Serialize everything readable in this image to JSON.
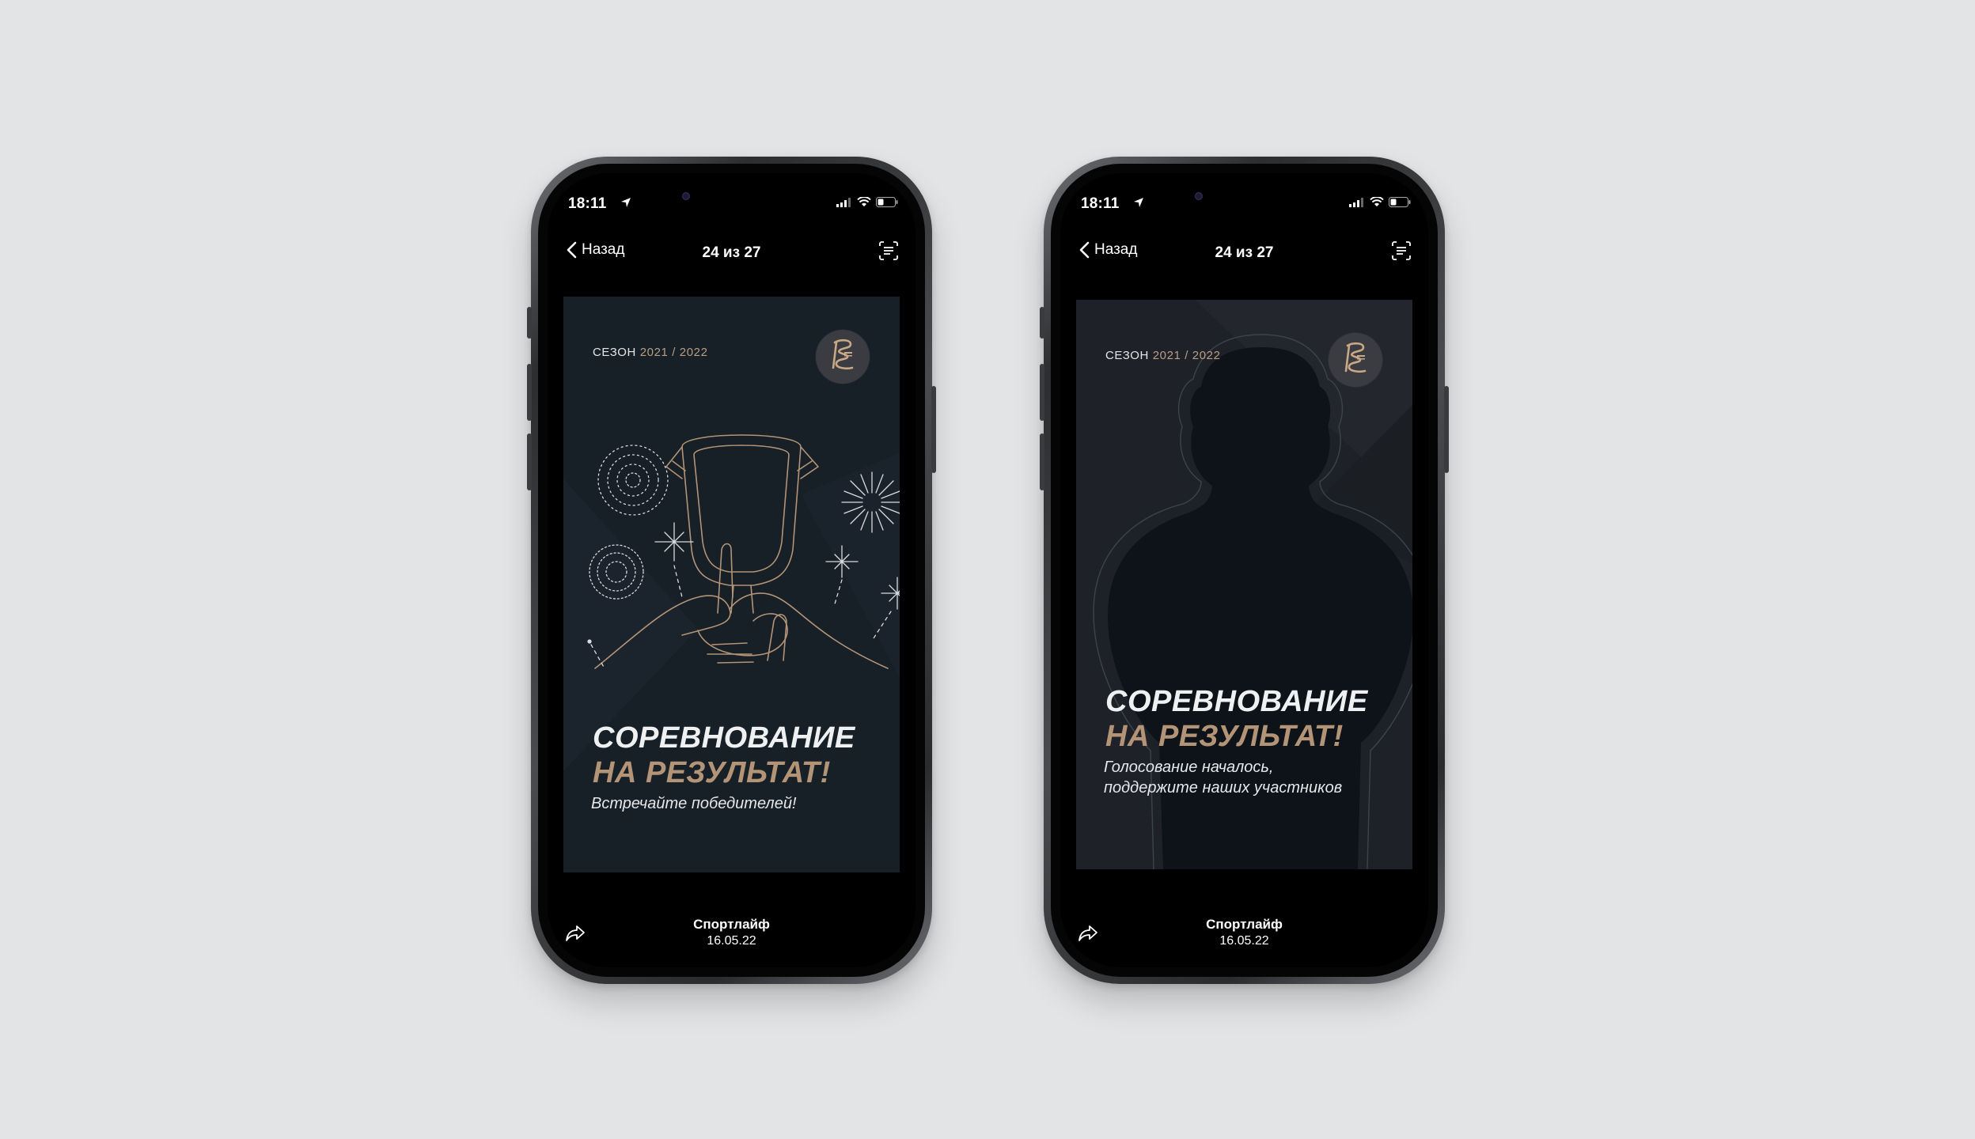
{
  "phones": [
    {
      "status": {
        "time": "18:11"
      },
      "nav": {
        "back_label": "Назад",
        "counter": "24 из 27"
      },
      "story": {
        "season_label": "СЕЗОН",
        "season_years": "2021 / 2022",
        "headline_line1": "СОРЕВНОВАНИЕ",
        "headline_line2": "НА РЕЗУЛЬТАТ!",
        "subtitle_line1": "Встречайте победителей!",
        "subtitle_line2": ""
      },
      "footer": {
        "source": "Спортлайф",
        "date": "16.05.22"
      }
    },
    {
      "status": {
        "time": "18:11"
      },
      "nav": {
        "back_label": "Назад",
        "counter": "24 из 27"
      },
      "story": {
        "season_label": "СЕЗОН",
        "season_years": "2021 / 2022",
        "headline_line1": "СОРЕВНОВАНИЕ",
        "headline_line2": "НА РЕЗУЛЬТАТ!",
        "subtitle_line1": "Голосование началось,",
        "subtitle_line2": "поддержите наших участников"
      },
      "footer": {
        "source": "Спортлайф",
        "date": "16.05.22"
      }
    }
  ],
  "colors": {
    "background": "#e3e4e6",
    "story_bg_1": "#171f27",
    "story_bg_2": "#1e2228",
    "accent_gold": "#b39477",
    "text_light": "#eef0f2"
  },
  "icons": [
    "back-chevron-icon",
    "location-arrow-icon",
    "signal-icon",
    "wifi-icon",
    "battery-icon",
    "text-scan-icon",
    "share-icon",
    "brand-logo-icon"
  ]
}
